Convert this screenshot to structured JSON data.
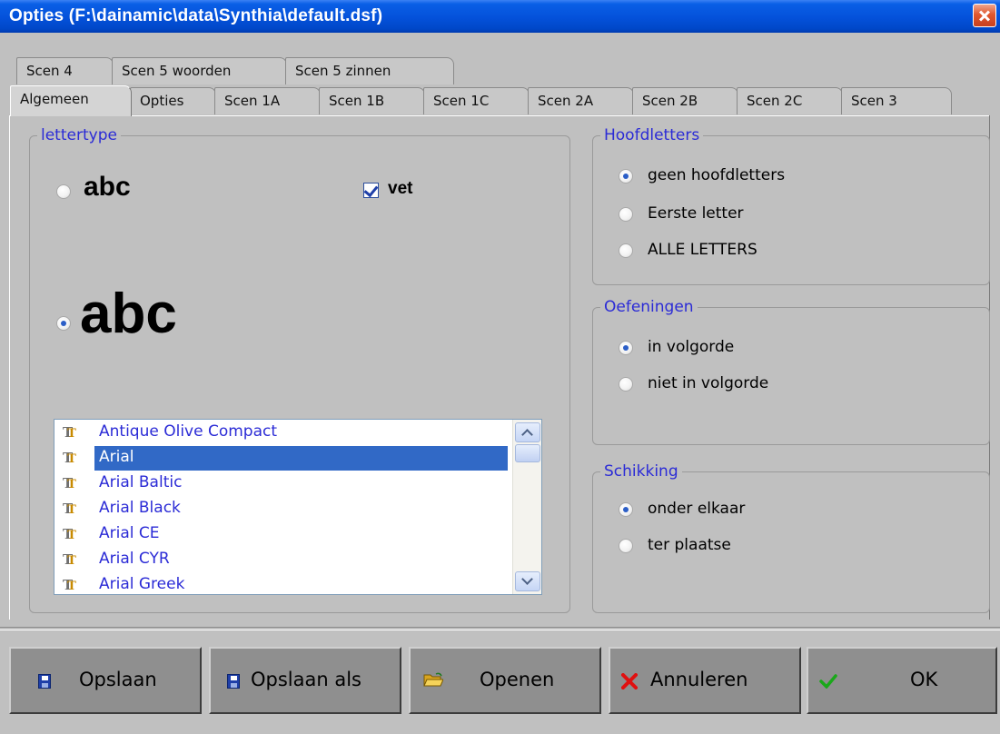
{
  "window": {
    "title": "Opties (F:\\dainamic\\data\\Synthia\\default.dsf)"
  },
  "tabs": {
    "row_top": [
      "Scen 4",
      "Scen 5 woorden",
      "Scen 5 zinnen"
    ],
    "row_bottom": [
      "Algemeen",
      "Opties",
      "Scen 1A",
      "Scen 1B",
      "Scen 1C",
      "Scen 2A",
      "Scen 2B",
      "Scen 2C",
      "Scen 3"
    ],
    "active": "Algemeen"
  },
  "lettertype": {
    "legend": "lettertype",
    "sample_small": "abc",
    "sample_large": "abc",
    "selected_sample": "large",
    "bold_label": "vet",
    "bold_checked": true,
    "fonts": [
      "Antique Olive Compact",
      "Arial",
      "Arial Baltic",
      "Arial Black",
      "Arial CE",
      "Arial CYR",
      "Arial Greek"
    ],
    "selected_font": "Arial"
  },
  "hoofdletters": {
    "legend": "Hoofdletters",
    "options": [
      "geen hoofdletters",
      "Eerste letter",
      "ALLE LETTERS"
    ],
    "selected": "geen hoofdletters"
  },
  "oefeningen": {
    "legend": "Oefeningen",
    "options": [
      "in volgorde",
      "niet in volgorde"
    ],
    "selected": "in volgorde"
  },
  "schikking": {
    "legend": "Schikking",
    "options": [
      "onder elkaar",
      "ter plaatse"
    ],
    "selected": "onder elkaar"
  },
  "buttons": {
    "save": "Opslaan",
    "save_as": "Opslaan als",
    "open": "Openen",
    "cancel": "Annuleren",
    "ok": "OK"
  }
}
